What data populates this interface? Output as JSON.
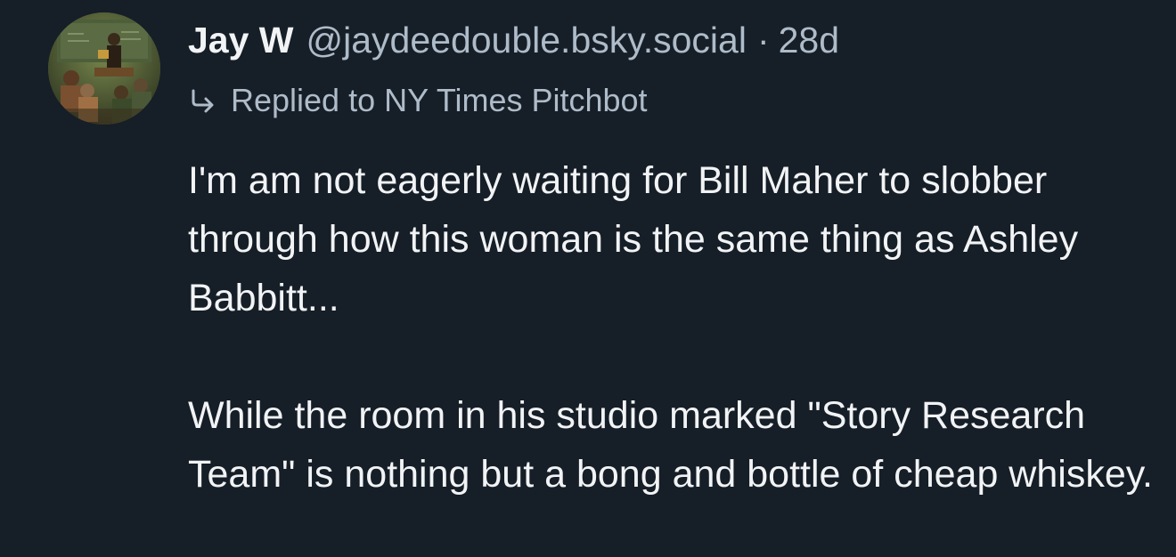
{
  "post": {
    "author": {
      "display_name": "Jay W",
      "handle": "@jaydeedouble.bsky.social",
      "avatar_icon": "avatar-painting"
    },
    "separator": "·",
    "timestamp": "28d",
    "reply": {
      "icon": "reply-arrow-icon",
      "text": "Replied to NY Times Pitchbot"
    },
    "body": {
      "paragraph_1": "I'm am not eagerly waiting for Bill Maher to slobber through how this woman is the same thing as Ashley Babbitt...",
      "paragraph_2": "While the room in his studio marked \"Story Research Team\" is nothing but a bong and bottle of cheap whiskey."
    }
  },
  "colors": {
    "background": "#161e27",
    "primary_text": "#f1f3f5",
    "secondary_text": "#aebbc9"
  }
}
